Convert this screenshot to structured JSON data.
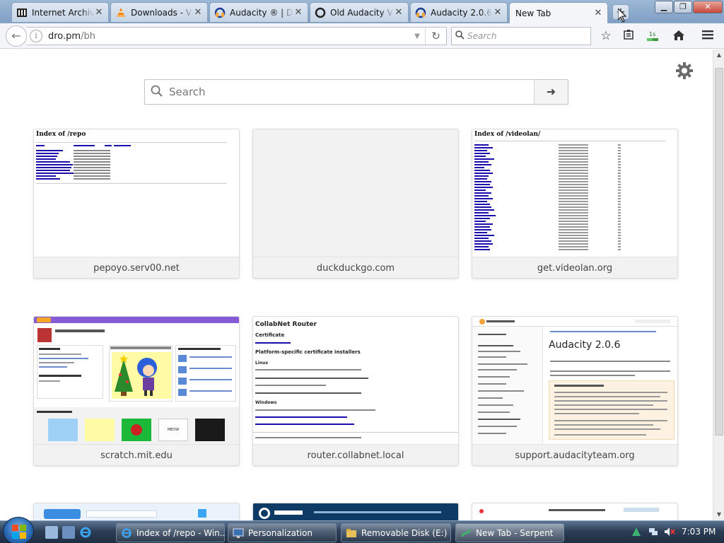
{
  "tabs": [
    {
      "title": "Internet Archive",
      "icon": "archive-icon"
    },
    {
      "title": "Downloads - VLC",
      "icon": "vlc-icon"
    },
    {
      "title": "Audacity ® | D",
      "icon": "audacity-icon"
    },
    {
      "title": "Old Audacity V",
      "icon": "globe-icon"
    },
    {
      "title": "Audacity 2.0.6",
      "icon": "audacity-icon"
    },
    {
      "title": "New Tab",
      "icon": "none"
    }
  ],
  "navbar": {
    "url_host": "dro.pm",
    "url_path": "/bh",
    "search_placeholder": "Search",
    "download_badge": "1s"
  },
  "newtab": {
    "search_placeholder": "Search",
    "tiles": [
      {
        "label": "pepoyo.serv00.net",
        "thumb_title": "Index of /repo"
      },
      {
        "label": "duckduckgo.com",
        "thumb_title": ""
      },
      {
        "label": "get.videolan.org",
        "thumb_title": "Index of /videolan/"
      },
      {
        "label": "scratch.mit.edu",
        "thumb_title": ""
      },
      {
        "label": "router.collabnet.local",
        "thumb_title": "CollabNet Router",
        "thumb_h1": "Certificate",
        "thumb_h2": "Platform-specific certificate installers",
        "thumb_h3": "Linux",
        "thumb_h4": "Windows"
      },
      {
        "label": "support.audacityteam.org",
        "thumb_title": "Audacity 2.0.6"
      }
    ]
  },
  "taskbar": {
    "items": [
      {
        "label": "Index of /repo - Win...",
        "icon": "ie-icon"
      },
      {
        "label": "Personalization",
        "icon": "monitor-icon"
      },
      {
        "label": "Removable Disk (E:)",
        "icon": "folder-icon"
      },
      {
        "label": "New Tab - Serpent",
        "icon": "serpent-icon"
      }
    ],
    "clock": "7:03 PM"
  },
  "colors": {
    "accent_blue": "#2a6cb6",
    "link_blue": "#1a0dab",
    "scratch_purple": "#855cd6",
    "audacity_orange": "#f2a33a"
  }
}
